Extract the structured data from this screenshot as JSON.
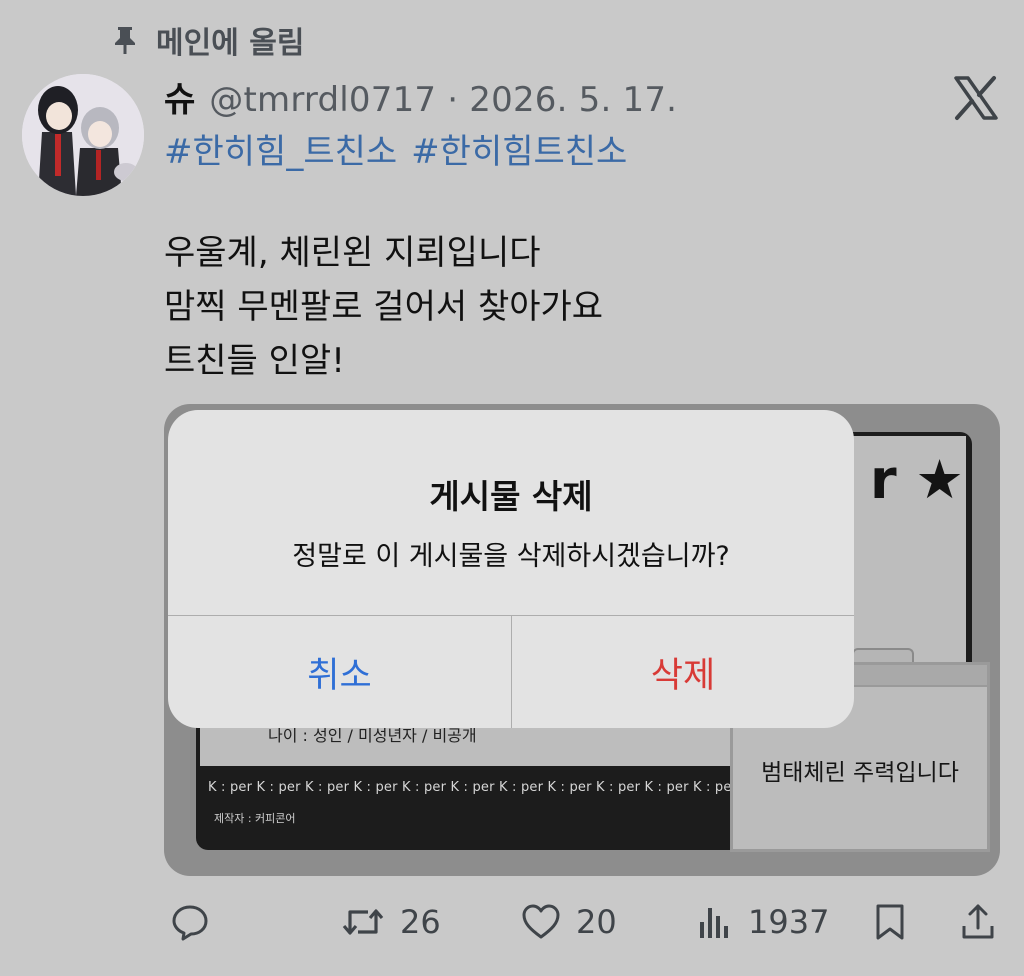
{
  "pinned": {
    "label": "메인에 올림",
    "icon": "pin-icon"
  },
  "author": {
    "name": "슈",
    "handle": "@tmrrdl0717",
    "separator": "·",
    "date": "2026. 5. 17."
  },
  "hashtags": [
    "#한히힘_트친소",
    "#한히힘트친소"
  ],
  "body_lines": [
    "우울계, 체린왼 지뢰입니다",
    "맘찍 무멘팔로 걸어서 찾아가요",
    "트친들 인알!"
  ],
  "media": {
    "title_fragment": "r ★",
    "age_label": "나이 : 성인 / 미성년자 / 비공개",
    "per_row": "K : per K : per K : per K : per K : per K : per K : per K : per K : per K : per K : per",
    "maker": "제작자 : 커피콘어",
    "note": "범태체린 주력입니다"
  },
  "alert": {
    "title": "게시물 삭제",
    "message": "정말로 이 게시물을 삭제하시겠습니까?",
    "cancel": "취소",
    "delete": "삭제"
  },
  "actions": {
    "retweets": "26",
    "likes": "20",
    "views": "1937"
  },
  "colors": {
    "link": "#3b6aa6",
    "cancel": "#2f6fd6",
    "delete": "#d83a36",
    "icon": "#3f4449"
  }
}
